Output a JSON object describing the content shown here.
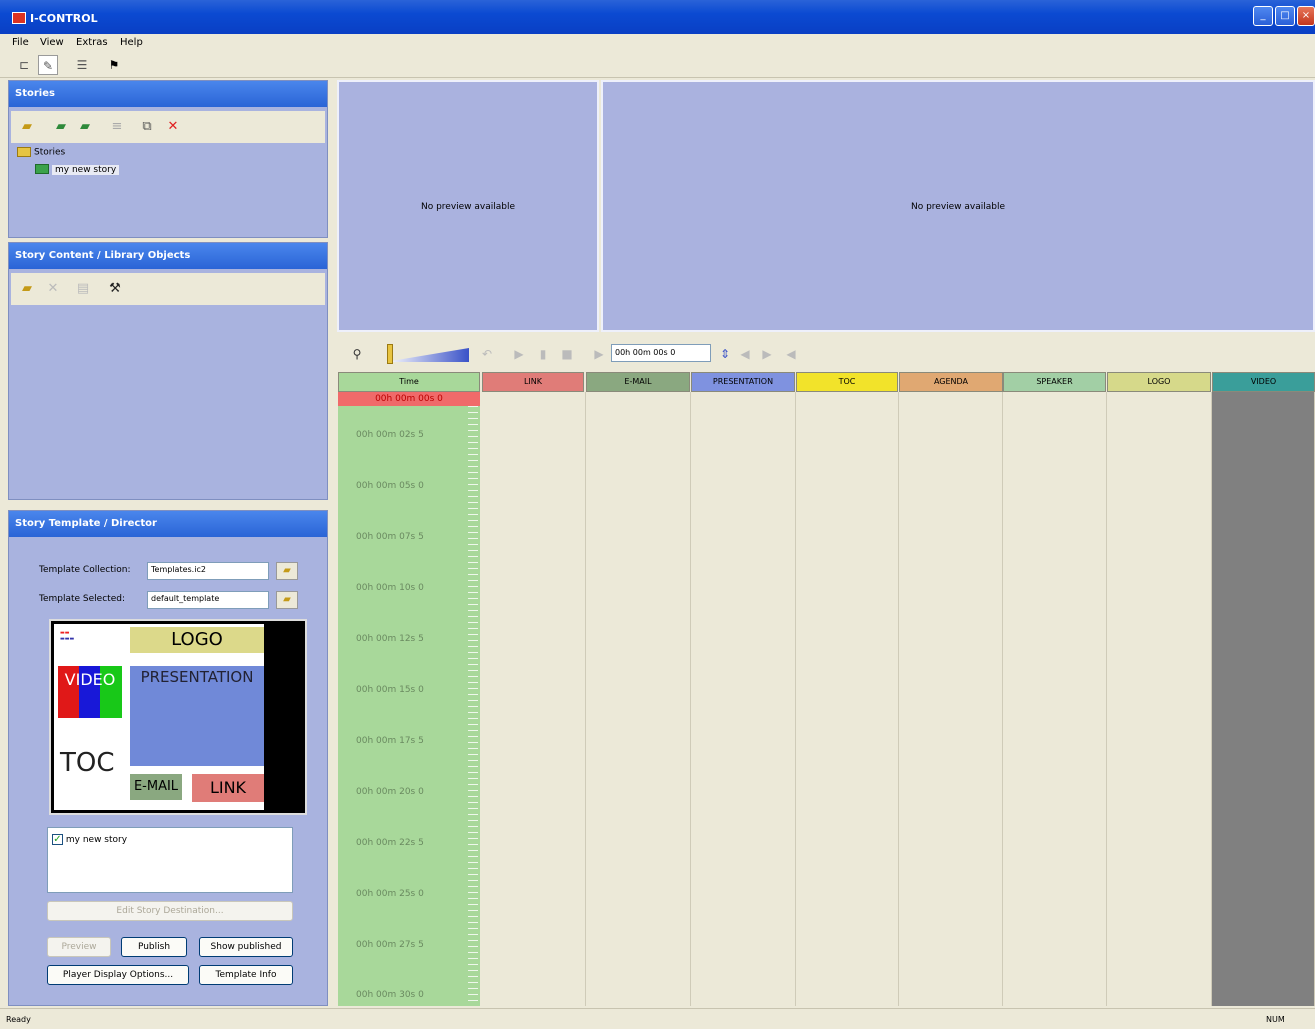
{
  "window": {
    "title": "I-CONTROL"
  },
  "menu": [
    "File",
    "View",
    "Extras",
    "Help"
  ],
  "stories_panel": {
    "title": "Stories",
    "tree": {
      "root": "Stories",
      "children": [
        "my new story"
      ]
    }
  },
  "content_panel": {
    "title": "Story Content / Library Objects"
  },
  "preview": {
    "left_text": "No preview available",
    "right_text": "No preview available"
  },
  "timeline_toolbar": {
    "time_value": "00h 00m 00s 0"
  },
  "timeline": {
    "columns": [
      {
        "label": "Time",
        "color": "#a8d89a"
      },
      {
        "label": "LINK",
        "color": "#e07c78"
      },
      {
        "label": "E-MAIL",
        "color": "#8aa880"
      },
      {
        "label": "PRESENTATION",
        "color": "#7f92e0"
      },
      {
        "label": "TOC",
        "color": "#f2e32a"
      },
      {
        "label": "AGENDA",
        "color": "#e0a872"
      },
      {
        "label": "SPEAKER",
        "color": "#a2cfa5"
      },
      {
        "label": "LOGO",
        "color": "#d6d98a"
      },
      {
        "label": "VIDEO",
        "color": "#3a9e9a"
      }
    ],
    "current_time": "00h 00m 00s 0",
    "time_marks": [
      "00h 00m 02s 5",
      "00h 00m 05s 0",
      "00h 00m 07s 5",
      "00h 00m 10s 0",
      "00h 00m 12s 5",
      "00h 00m 15s 0",
      "00h 00m 17s 5",
      "00h 00m 20s 0",
      "00h 00m 22s 5",
      "00h 00m 25s 0",
      "00h 00m 27s 5",
      "00h 00m 30s 0"
    ]
  },
  "director": {
    "title": "Story Template / Director",
    "collection_label": "Template Collection:",
    "collection_value": "Templates.ic2",
    "selected_label": "Template Selected:",
    "selected_value": "default_template",
    "template_preview": {
      "logo": "LOGO",
      "video": "VIDEO",
      "presentation": "PRESENTATION",
      "toc": "TOC",
      "email": "E-MAIL",
      "link": "LINK"
    },
    "story_checkbox_label": "my new story",
    "edit_button": "Edit Story Destination...",
    "preview_button": "Preview",
    "publish_button": "Publish",
    "show_published_button": "Show published",
    "player_options_button": "Player Display Options...",
    "template_info_button": "Template Info"
  },
  "status": {
    "left": "Ready",
    "right": "NUM"
  }
}
